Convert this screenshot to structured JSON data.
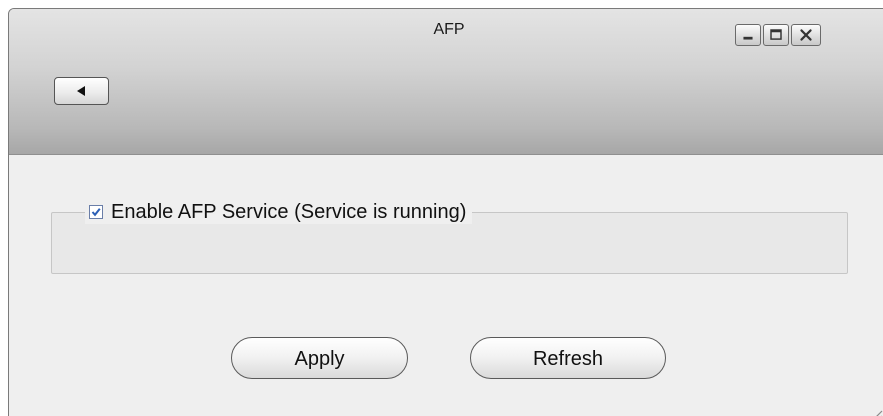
{
  "window": {
    "title": "AFP",
    "controls": {
      "minimize": "minimize-icon",
      "maximize": "maximize-icon",
      "close": "close-icon"
    }
  },
  "toolbar": {
    "back_icon": "back-arrow-icon"
  },
  "service": {
    "enable_label": "Enable AFP Service (Service is running)",
    "enabled": true
  },
  "actions": {
    "apply_label": "Apply",
    "refresh_label": "Refresh"
  },
  "colors": {
    "titlebar_gradient_top": "#e4e4e4",
    "titlebar_gradient_bottom": "#a7a7a7",
    "content_background": "#efefef",
    "checkbox_check": "#2b5fb5"
  }
}
